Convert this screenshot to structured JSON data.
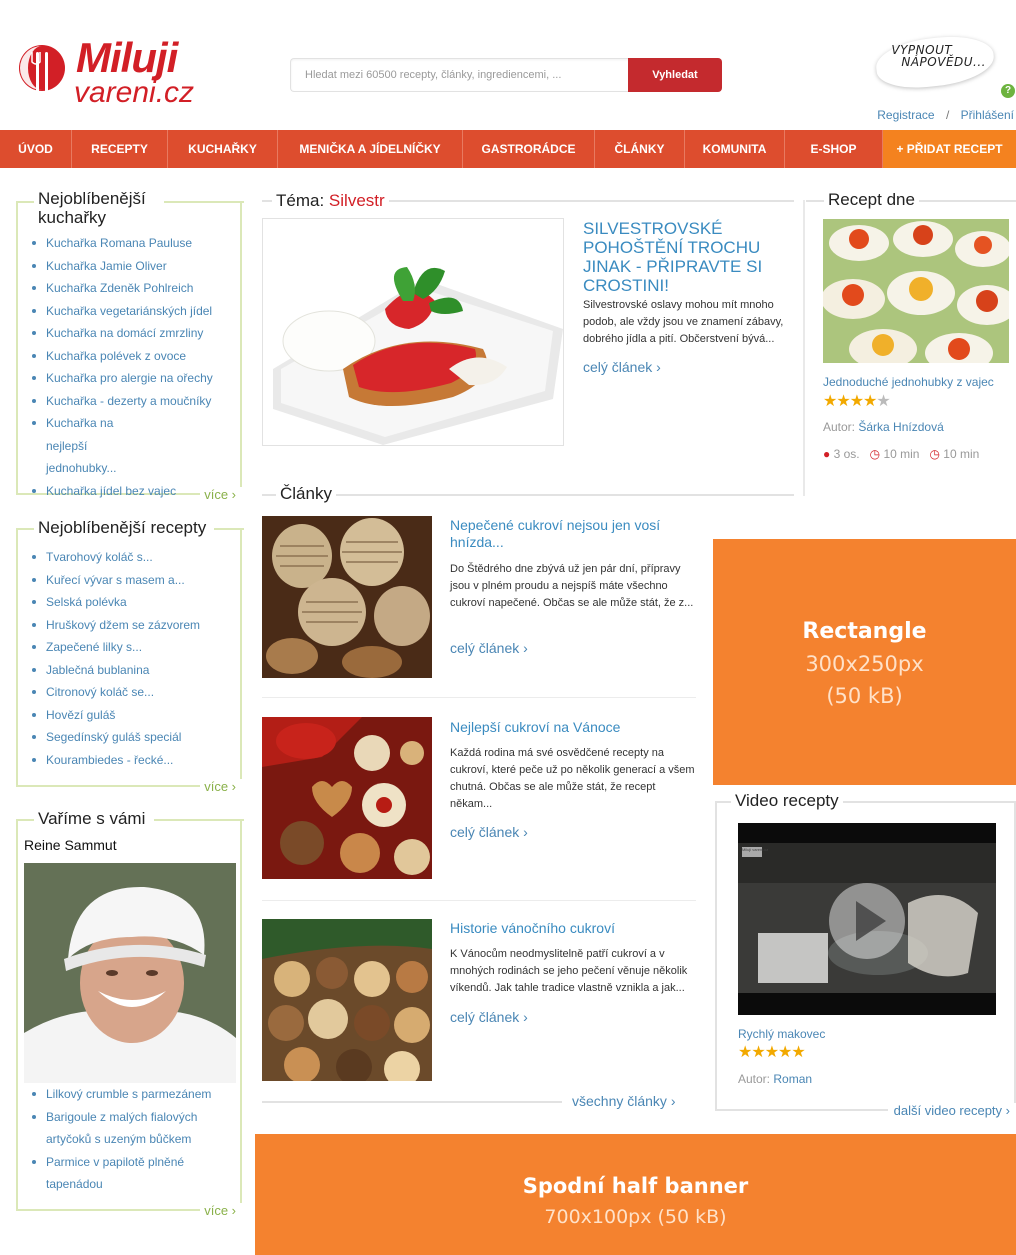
{
  "logo": {
    "top": "Miluji",
    "bottom": "vareni.cz"
  },
  "search": {
    "placeholder": "Hledat mezi 60500 recepty, články, ingrediencemi, ...",
    "button": "Vyhledat"
  },
  "help": {
    "line1": "VYPNOUT",
    "line2": "NÁPOVĚDU...",
    "icon": "?"
  },
  "auth": {
    "register": "Registrace",
    "separator": "/",
    "login": "Přihlášení"
  },
  "nav": [
    "ÚVOD",
    "RECEPTY",
    "KUCHAŘKY",
    "MENIČKA A JÍDELNÍČKY",
    "GASTRORÁDCE",
    "ČLÁNKY",
    "KOMUNITA",
    "E-SHOP",
    "+ PŘIDAT RECEPT"
  ],
  "cookbooks": {
    "title": "Nejoblíbenější kuchařky",
    "items": [
      "Kuchařka Romana Pauluse",
      "Kuchařka Jamie Oliver",
      "Kuchařka Zdeněk Pohlreich",
      "Kuchařka vegetariánských jídel",
      "Kuchařka na domácí zmrzliny",
      "Kuchařka polévek z ovoce",
      "Kuchařka pro alergie na ořechy",
      "Kuchařka - dezerty a moučníky",
      "Kuchařka na nejlepší jednohubky...",
      "Kuchařka jídel bez vajec"
    ],
    "more": "více ›"
  },
  "recipes": {
    "title": "Nejoblíbenější recepty",
    "items": [
      "Tvarohový koláč s...",
      "Kuřecí vývar s masem a...",
      "Selská polévka",
      "Hruškový džem se zázvorem",
      "Zapečené lilky s...",
      "Jablečná bublanina",
      "Citronový koláč se...",
      "Hovězí guláš",
      "Segedínský guláš speciál",
      "Kourambiedes - řecké..."
    ],
    "more": "více ›"
  },
  "cooking": {
    "title": "Vaříme s vámi",
    "name": "Reine Sammut",
    "items": [
      "Lilkový crumble s parmezánem",
      "Barigoule z malých fialových artyčoků s uzeným bůčkem",
      "Parmice v papilotě plněné tapenádou"
    ],
    "more": "více ›"
  },
  "theme": {
    "label": "Téma:",
    "name": "Silvestr",
    "headline": "SILVESTROVSKÉ POHOŠTĚNÍ TROCHU JINAK - PŘIPRAVTE SI CROSTINI!",
    "perex": "Silvestrovské oslavy mohou mít mnoho podob, ale vždy jsou ve znamení zábavy, dobrého jídla a pití. Občerstvení bývá...",
    "readmore": "celý článek ›"
  },
  "articles": {
    "title": "Články",
    "items": [
      {
        "title": "Nepečené cukroví nejsou jen vosí hnízda...",
        "text": "Do Štědrého dne zbývá už jen pár dní, přípravy jsou v plném proudu a nejspíš máte všechno cukroví napečené. Občas se ale může stát, že z...",
        "readmore": "celý článek ›"
      },
      {
        "title": "Nejlepší cukroví na Vánoce",
        "text": "Každá rodina má své osvědčené recepty na cukroví, které peče už po několik generací a všem chutná. Občas se ale může stát, že recept někam...",
        "readmore": "celý článek ›"
      },
      {
        "title": "Historie vánočního cukroví",
        "text": "K Vánocům neodmyslitelně patří cukroví a v mnohých rodinách se jeho pečení věnuje několik víkendů. Jak tahle tradice vlastně vznikla a jak...",
        "readmore": "celý článek ›"
      }
    ],
    "all": "všechny články ›"
  },
  "recipe_of_day": {
    "title": "Recept dne",
    "name": "Jednoduché jednohubky z vajec",
    "rating": 4,
    "author_label": "Autor:",
    "author": "Šárka Hnízdová",
    "persons": "3 os.",
    "prep": "10 min",
    "cook": "10 min"
  },
  "rectangle": {
    "title": "Rectangle",
    "size": "300x250px",
    "weight": "(50 kB)"
  },
  "video": {
    "title": "Video recepty",
    "name": "Rychlý makovec",
    "rating": 5,
    "author_label": "Autor:",
    "author": "Roman",
    "more": "další video recepty ›",
    "watermark": "Miluji vareni.cz"
  },
  "bottom_banner": {
    "title": "Spodní half banner",
    "size": "700x100px (50 kB)"
  },
  "colors": {
    "brand_red": "#d21f26",
    "nav_bg": "#dd4d2e",
    "nav_add": "#f4821f",
    "link": "#4a86b4",
    "banner": "#f4822f",
    "box_border": "#dbe8b8"
  }
}
